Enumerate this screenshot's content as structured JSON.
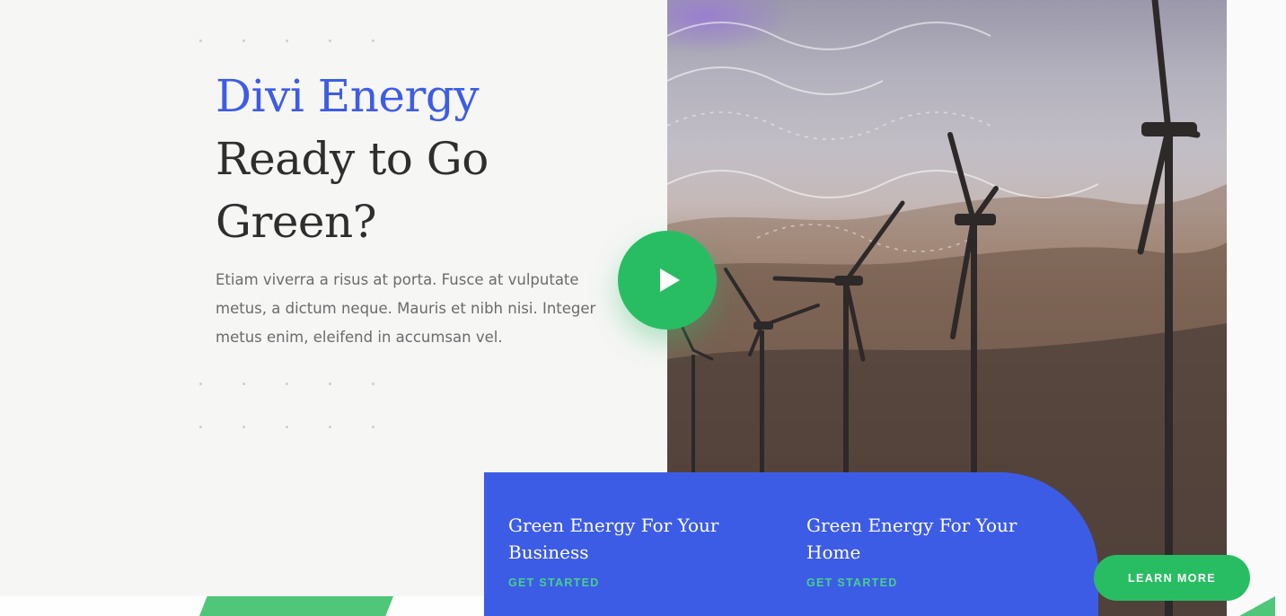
{
  "hero": {
    "title_accent": "Divi Energy",
    "title_line2": "Ready to Go",
    "title_line3": "Green?",
    "body": "Etiam viverra a risus at porta. Fusce at vulputate metus, a dictum neque. Mauris et nibh nisi. Integer metus enim, eleifend in accumsan vel."
  },
  "video": {
    "play_icon": "play-icon"
  },
  "cta": {
    "items": [
      {
        "title": "Green Energy For Your Business",
        "link": "GET STARTED"
      },
      {
        "title": "Green Energy For Your Home",
        "link": "GET STARTED"
      }
    ]
  },
  "learn_more": {
    "label": "LEARN MORE"
  },
  "colors": {
    "accent_blue": "#3d5ce6",
    "brand_green": "#29bd63",
    "link_green": "#45d18a",
    "heading_dark": "#2e2e2e",
    "body_gray": "#6b6b6b"
  }
}
